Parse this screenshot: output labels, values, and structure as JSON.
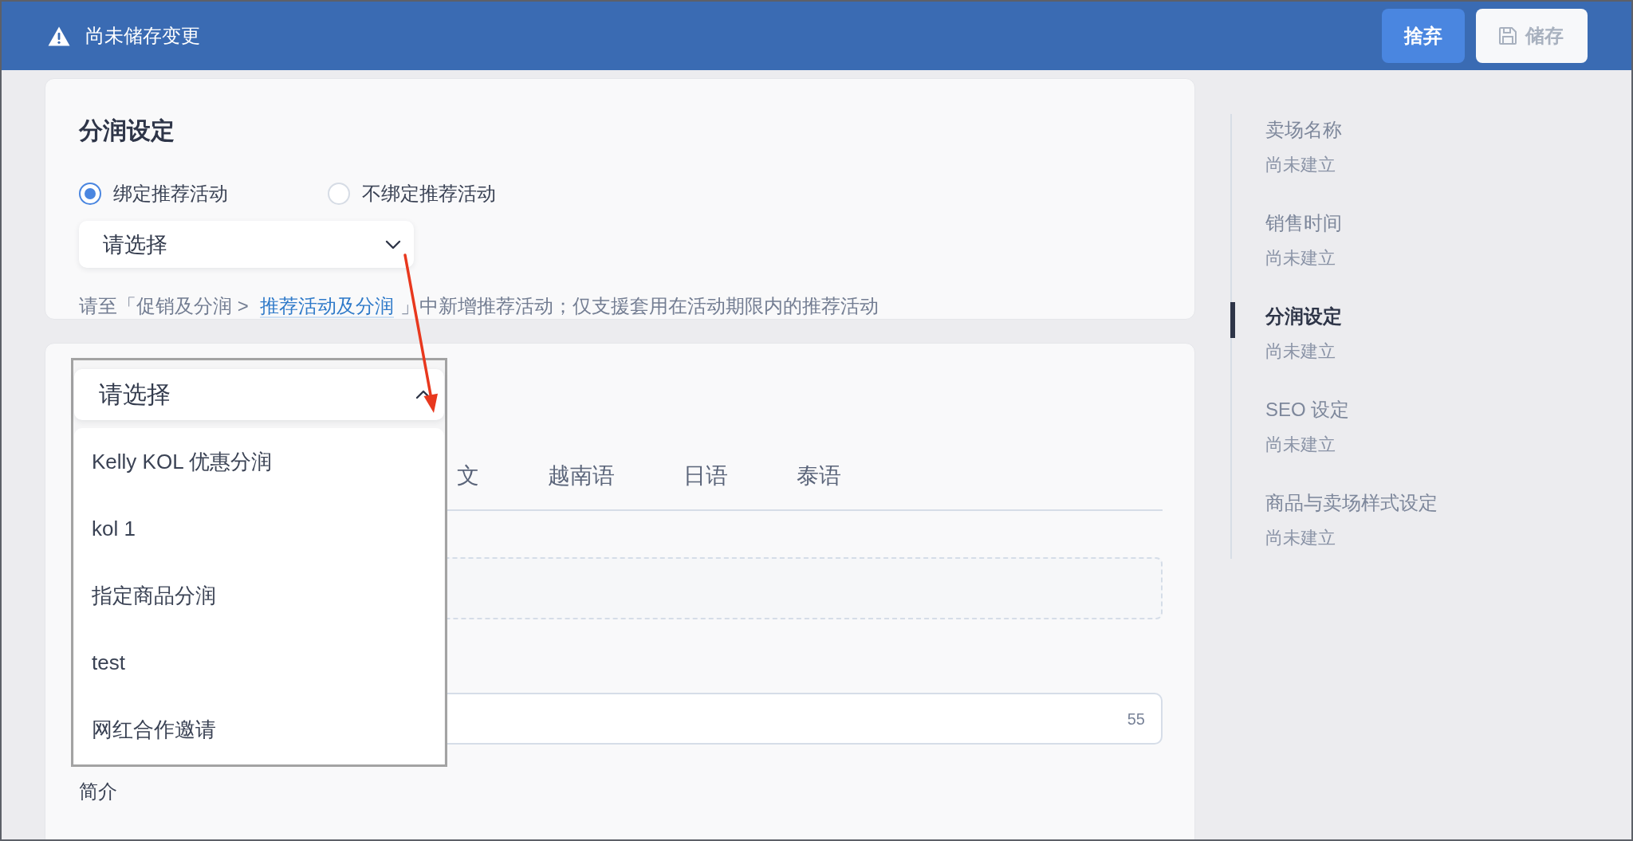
{
  "top_bar": {
    "title": "尚未储存变更",
    "buttons": [
      {
        "label": "捨弃",
        "kind": "discard",
        "disabled": false
      },
      {
        "label": "储存",
        "kind": "save",
        "disabled": true
      }
    ]
  },
  "commission_card": {
    "title": "分润设定",
    "radios": [
      {
        "label": "绑定推荐活动",
        "selected": true
      },
      {
        "label": "不绑定推荐活动",
        "selected": false
      }
    ],
    "select": {
      "placeholder": "请选择",
      "expanded": false
    },
    "hint": {
      "text_before": "请至「促销及分润 > ",
      "link": "推荐活动及分润",
      "text_after": "」中新增推荐活动；仅支援套用在活动期限内的推荐活动"
    }
  },
  "content_card": {
    "tabs": [
      {
        "label": "文",
        "selected": false
      },
      {
        "label": "越南语",
        "selected": false
      },
      {
        "label": "日语",
        "selected": false
      },
      {
        "label": "泰语",
        "selected": false
      }
    ],
    "text_field": {
      "counter": "55"
    },
    "label": "简介"
  },
  "zoomed_dropdown": {
    "select": {
      "placeholder": "请选择",
      "expanded": true
    },
    "options": [
      "Kelly KOL 优惠分润",
      "kol 1",
      "指定商品分润",
      "test",
      "网红合作邀请"
    ]
  },
  "section_nav": {
    "items": [
      {
        "title": "卖场名称",
        "status": "尚未建立",
        "selected": false
      },
      {
        "title": "销售时间",
        "status": "尚未建立",
        "selected": false
      },
      {
        "title": "分润设定",
        "status": "尚未建立",
        "selected": true
      },
      {
        "title": "SEO 设定",
        "status": "尚未建立",
        "selected": false
      },
      {
        "title": "商品与卖场样式设定",
        "status": "尚未建立",
        "selected": false
      }
    ]
  }
}
